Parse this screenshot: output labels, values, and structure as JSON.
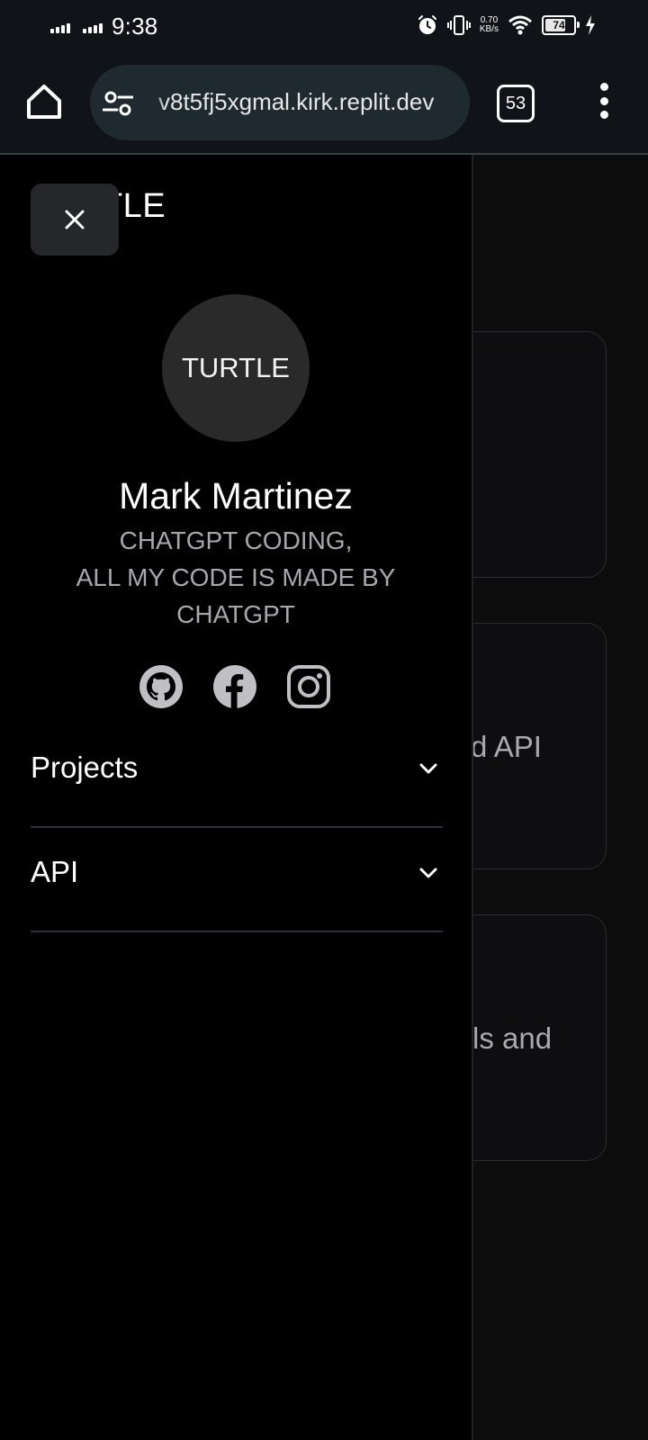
{
  "status_bar": {
    "time": "9:38",
    "net_speed_value": "0.70",
    "net_speed_unit": "KB/s",
    "battery_level": "74",
    "icons": [
      "signal-icon",
      "signal-icon",
      "alarm-icon",
      "vibrate-icon",
      "wifi-icon",
      "battery-icon",
      "charging-icon"
    ]
  },
  "browser": {
    "url": "v8t5fj5xgmal.kirk.replit.dev",
    "tab_count": "53",
    "icons": [
      "home-icon",
      "site-settings-icon",
      "more-options-icon"
    ]
  },
  "drawer": {
    "brand": "TURTLE",
    "avatar_text": "TURTLE",
    "name": "Mark Martinez",
    "bio_lines": [
      "CHATGPT CODING,",
      "ALL MY CODE IS MADE BY",
      "CHATGPT"
    ],
    "socials": [
      "github-icon",
      "facebook-icon",
      "instagram-icon"
    ],
    "nav": [
      {
        "label": "Projects"
      },
      {
        "label": "API"
      }
    ]
  },
  "background_cards": [
    {
      "text": ""
    },
    {
      "text": "d API"
    },
    {
      "text": "ls and"
    }
  ],
  "colors": {
    "background": "#000000",
    "chrome": "#101418",
    "url_box": "#1f2a30",
    "avatar": "#2a2a2b",
    "muted_text": "#a7a7ad"
  }
}
